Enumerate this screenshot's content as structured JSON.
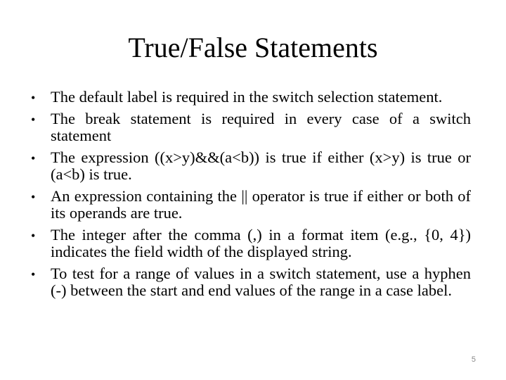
{
  "slide": {
    "title": "True/False Statements",
    "bullet_glyph": "•",
    "bullets": [
      {
        "text": "The default label is required in the switch selection statement."
      },
      {
        "text": "The break statement is required in every case of a switch statement"
      },
      {
        "text": "The expression ((x>y)&&(a<b)) is true if either (x>y) is true or (a<b) is true."
      },
      {
        "text": "An expression containing the || operator is true if either or both of its operands are true."
      },
      {
        "text": "The integer after the comma (,) in a format item (e.g., {0, 4}) indicates the field width of the displayed string."
      },
      {
        "text": "To test for a range of values in a switch statement, use a hyphen (-) between the start and end values of the range in a case label."
      }
    ],
    "page_number": "5"
  }
}
